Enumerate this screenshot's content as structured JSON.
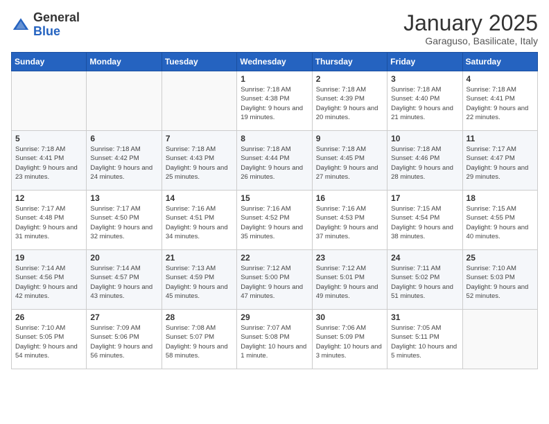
{
  "logo": {
    "general": "General",
    "blue": "Blue"
  },
  "title": "January 2025",
  "subtitle": "Garaguso, Basilicate, Italy",
  "days_header": [
    "Sunday",
    "Monday",
    "Tuesday",
    "Wednesday",
    "Thursday",
    "Friday",
    "Saturday"
  ],
  "weeks": [
    [
      {
        "day": "",
        "info": ""
      },
      {
        "day": "",
        "info": ""
      },
      {
        "day": "",
        "info": ""
      },
      {
        "day": "1",
        "info": "Sunrise: 7:18 AM\nSunset: 4:38 PM\nDaylight: 9 hours\nand 19 minutes."
      },
      {
        "day": "2",
        "info": "Sunrise: 7:18 AM\nSunset: 4:39 PM\nDaylight: 9 hours\nand 20 minutes."
      },
      {
        "day": "3",
        "info": "Sunrise: 7:18 AM\nSunset: 4:40 PM\nDaylight: 9 hours\nand 21 minutes."
      },
      {
        "day": "4",
        "info": "Sunrise: 7:18 AM\nSunset: 4:41 PM\nDaylight: 9 hours\nand 22 minutes."
      }
    ],
    [
      {
        "day": "5",
        "info": "Sunrise: 7:18 AM\nSunset: 4:41 PM\nDaylight: 9 hours\nand 23 minutes."
      },
      {
        "day": "6",
        "info": "Sunrise: 7:18 AM\nSunset: 4:42 PM\nDaylight: 9 hours\nand 24 minutes."
      },
      {
        "day": "7",
        "info": "Sunrise: 7:18 AM\nSunset: 4:43 PM\nDaylight: 9 hours\nand 25 minutes."
      },
      {
        "day": "8",
        "info": "Sunrise: 7:18 AM\nSunset: 4:44 PM\nDaylight: 9 hours\nand 26 minutes."
      },
      {
        "day": "9",
        "info": "Sunrise: 7:18 AM\nSunset: 4:45 PM\nDaylight: 9 hours\nand 27 minutes."
      },
      {
        "day": "10",
        "info": "Sunrise: 7:18 AM\nSunset: 4:46 PM\nDaylight: 9 hours\nand 28 minutes."
      },
      {
        "day": "11",
        "info": "Sunrise: 7:17 AM\nSunset: 4:47 PM\nDaylight: 9 hours\nand 29 minutes."
      }
    ],
    [
      {
        "day": "12",
        "info": "Sunrise: 7:17 AM\nSunset: 4:48 PM\nDaylight: 9 hours\nand 31 minutes."
      },
      {
        "day": "13",
        "info": "Sunrise: 7:17 AM\nSunset: 4:50 PM\nDaylight: 9 hours\nand 32 minutes."
      },
      {
        "day": "14",
        "info": "Sunrise: 7:16 AM\nSunset: 4:51 PM\nDaylight: 9 hours\nand 34 minutes."
      },
      {
        "day": "15",
        "info": "Sunrise: 7:16 AM\nSunset: 4:52 PM\nDaylight: 9 hours\nand 35 minutes."
      },
      {
        "day": "16",
        "info": "Sunrise: 7:16 AM\nSunset: 4:53 PM\nDaylight: 9 hours\nand 37 minutes."
      },
      {
        "day": "17",
        "info": "Sunrise: 7:15 AM\nSunset: 4:54 PM\nDaylight: 9 hours\nand 38 minutes."
      },
      {
        "day": "18",
        "info": "Sunrise: 7:15 AM\nSunset: 4:55 PM\nDaylight: 9 hours\nand 40 minutes."
      }
    ],
    [
      {
        "day": "19",
        "info": "Sunrise: 7:14 AM\nSunset: 4:56 PM\nDaylight: 9 hours\nand 42 minutes."
      },
      {
        "day": "20",
        "info": "Sunrise: 7:14 AM\nSunset: 4:57 PM\nDaylight: 9 hours\nand 43 minutes."
      },
      {
        "day": "21",
        "info": "Sunrise: 7:13 AM\nSunset: 4:59 PM\nDaylight: 9 hours\nand 45 minutes."
      },
      {
        "day": "22",
        "info": "Sunrise: 7:12 AM\nSunset: 5:00 PM\nDaylight: 9 hours\nand 47 minutes."
      },
      {
        "day": "23",
        "info": "Sunrise: 7:12 AM\nSunset: 5:01 PM\nDaylight: 9 hours\nand 49 minutes."
      },
      {
        "day": "24",
        "info": "Sunrise: 7:11 AM\nSunset: 5:02 PM\nDaylight: 9 hours\nand 51 minutes."
      },
      {
        "day": "25",
        "info": "Sunrise: 7:10 AM\nSunset: 5:03 PM\nDaylight: 9 hours\nand 52 minutes."
      }
    ],
    [
      {
        "day": "26",
        "info": "Sunrise: 7:10 AM\nSunset: 5:05 PM\nDaylight: 9 hours\nand 54 minutes."
      },
      {
        "day": "27",
        "info": "Sunrise: 7:09 AM\nSunset: 5:06 PM\nDaylight: 9 hours\nand 56 minutes."
      },
      {
        "day": "28",
        "info": "Sunrise: 7:08 AM\nSunset: 5:07 PM\nDaylight: 9 hours\nand 58 minutes."
      },
      {
        "day": "29",
        "info": "Sunrise: 7:07 AM\nSunset: 5:08 PM\nDaylight: 10 hours\nand 1 minute."
      },
      {
        "day": "30",
        "info": "Sunrise: 7:06 AM\nSunset: 5:09 PM\nDaylight: 10 hours\nand 3 minutes."
      },
      {
        "day": "31",
        "info": "Sunrise: 7:05 AM\nSunset: 5:11 PM\nDaylight: 10 hours\nand 5 minutes."
      },
      {
        "day": "",
        "info": ""
      }
    ]
  ]
}
